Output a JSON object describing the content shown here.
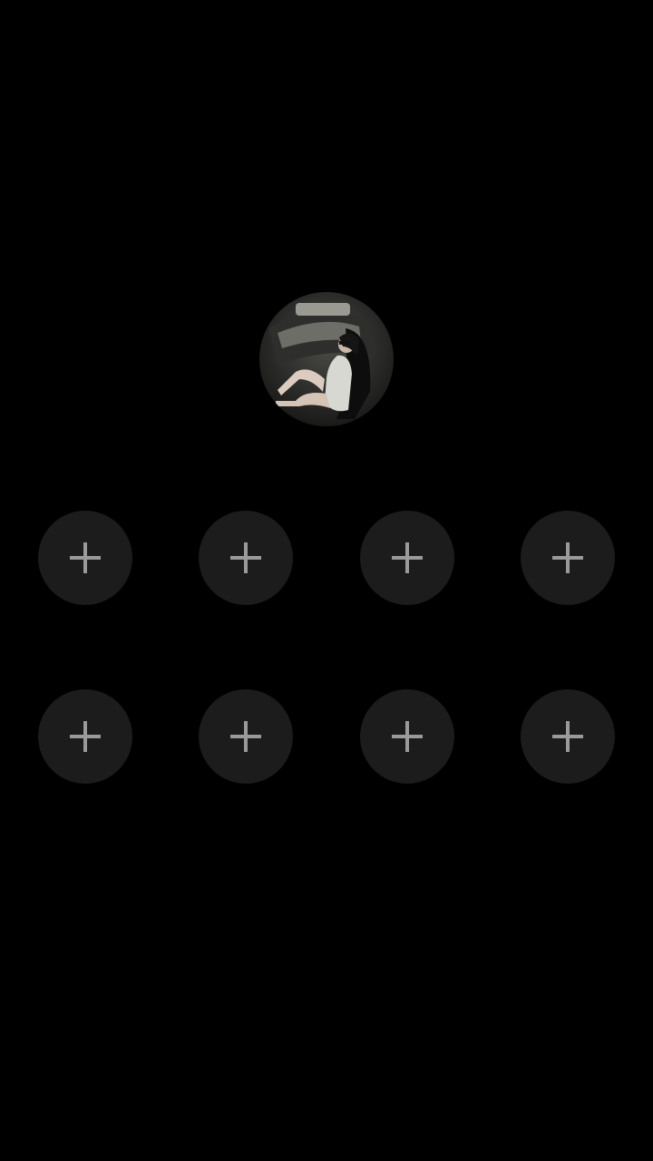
{
  "avatar": {
    "icon": "profile-photo",
    "description_visible_text": ""
  },
  "slots": {
    "icon": "plus-icon",
    "count": 8,
    "background_color": "#1c1c1c",
    "plus_color": "#9a9a9a"
  },
  "colors": {
    "background": "#000000"
  }
}
